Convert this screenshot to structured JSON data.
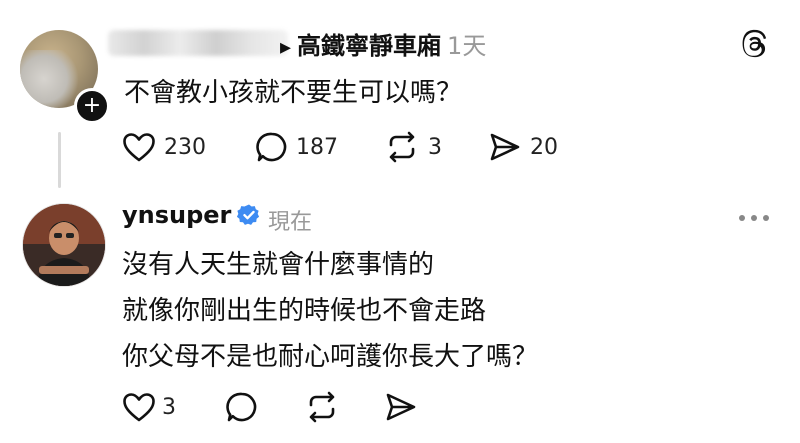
{
  "post1": {
    "channel": "高鐵寧靜車廂",
    "time": "1天",
    "body": "不會教小孩就不要生可以嗎？",
    "stats": {
      "likes": "230",
      "comments": "187",
      "reposts": "3",
      "shares": "20"
    },
    "plus_label": "+"
  },
  "post2": {
    "username": "ynsuper",
    "time": "現在",
    "lines": [
      "沒有人天生就會什麼事情的",
      "就像你剛出生的時候也不會走路",
      "你父母不是也耐心呵護你長大了嗎？"
    ],
    "stats": {
      "likes": "3"
    }
  },
  "icons": {
    "like": "heart-icon",
    "comment": "comment-bubble-icon",
    "repost": "repost-icon",
    "share": "send-icon",
    "more": "more-dots-icon",
    "logo": "threads-logo-icon",
    "verified": "verified-badge-icon"
  },
  "colors": {
    "verified": "#3d8bf2",
    "muted": "#999999",
    "thread_line": "#d9d9d9"
  }
}
